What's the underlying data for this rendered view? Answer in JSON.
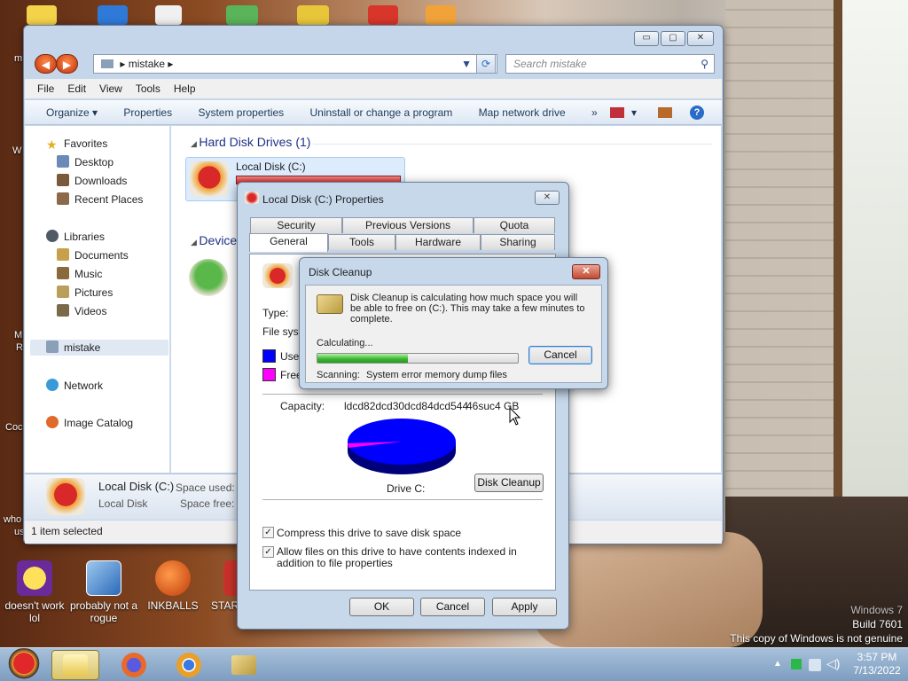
{
  "desktop": {
    "icons": [
      {
        "label": "doesn't work lol"
      },
      {
        "label": "probably not a rogue"
      },
      {
        "label": "INKBALLS"
      },
      {
        "label": "STAR"
      }
    ],
    "edge_fragments": [
      "m",
      "W",
      "M",
      "R",
      "Coc",
      "who",
      "us"
    ],
    "watermark": {
      "line1": "Windows 7",
      "line2": "Build 7601",
      "line3": "This copy of Windows is not genuine"
    }
  },
  "explorer": {
    "address": "mistake",
    "search_placeholder": "Search mistake",
    "window_buttons": {
      "minimize": "▭",
      "maximize": "▢",
      "close": "✕"
    },
    "menu": [
      "File",
      "Edit",
      "View",
      "Tools",
      "Help"
    ],
    "toolbar": {
      "organize": "Organize ▾",
      "properties": "Properties",
      "system_properties": "System properties",
      "uninstall": "Uninstall or change a program",
      "map_drive": "Map network drive",
      "more": "»"
    },
    "sidebar": {
      "favorites": "Favorites",
      "desktop": "Desktop",
      "downloads": "Downloads",
      "recent": "Recent Places",
      "libraries": "Libraries",
      "documents": "Documents",
      "music": "Music",
      "pictures": "Pictures",
      "videos": "Videos",
      "mistake": "mistake",
      "network": "Network",
      "image_catalog": "Image Catalog"
    },
    "content": {
      "hdd_header": "Hard Disk Drives (1)",
      "drive_label": "Local Disk (C:)",
      "devices_header": "Devices"
    },
    "details": {
      "name": "Local Disk (C:)",
      "type": "Local Disk",
      "space_used_label": "Space used:",
      "space_free_label": "Space free:"
    },
    "status": "1 item selected"
  },
  "properties": {
    "title": "Local Disk (C:) Properties",
    "close": "✕",
    "tabs_back": [
      "Security",
      "Previous Versions",
      "Quota"
    ],
    "tabs_front": [
      "General",
      "Tools",
      "Hardware",
      "Sharing"
    ],
    "type_label": "Type:",
    "fs_label": "File syste",
    "used_label": "Use",
    "free_label": "Free",
    "capacity_label": "Capacity:",
    "capacity_bytes": "ldcd82dcd30dcd84dcd544",
    "capacity_gb": "46suc4 GB",
    "drive_caption": "Drive C:",
    "disk_cleanup_btn": "Disk Cleanup",
    "compress_label": "Compress this drive to save disk space",
    "index_label": "Allow files on this drive to have contents indexed in addition to file properties",
    "ok": "OK",
    "cancel": "Cancel",
    "apply": "Apply",
    "colors": {
      "used": "#0000ff",
      "free": "#ff00ff"
    },
    "used_fraction": 0.97
  },
  "cleanup": {
    "title": "Disk Cleanup",
    "close": "✕",
    "message": "Disk Cleanup is calculating how much space you will be able to free on  (C:). This may take a few minutes to complete.",
    "calculating": "Calculating...",
    "cancel": "Cancel",
    "progress": 0.45,
    "scanning_label": "Scanning:",
    "scanning_item": "System error memory dump files"
  },
  "taskbar": {
    "time": "3:57 PM",
    "date": "7/13/2022"
  }
}
